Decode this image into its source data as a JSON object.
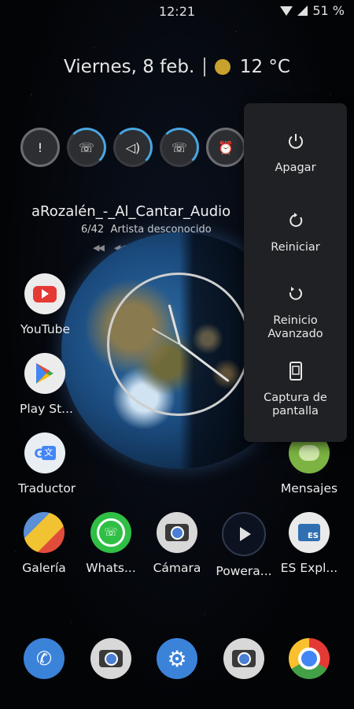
{
  "status_bar": {
    "time": "12:21",
    "battery": "51 %"
  },
  "header": {
    "date": "Viernes, 8 feb.",
    "temperature": "12 °C"
  },
  "music": {
    "title": "aRozalén_-_Al_Cantar_Audio",
    "track": "6/42",
    "artist": "Artista desconocido"
  },
  "home_apps": [
    {
      "label": "YouTube"
    },
    {
      "label": "Play St..."
    },
    {
      "label": "Traductor"
    },
    {
      "label": "Mensajes"
    },
    {
      "label": "Galería"
    },
    {
      "label": "Whats..."
    },
    {
      "label": "Cámara"
    },
    {
      "label": "Powera..."
    },
    {
      "label": "ES Expl..."
    }
  ],
  "power_menu": {
    "items": [
      {
        "label": "Apagar",
        "icon": "power-icon"
      },
      {
        "label": "Reiniciar",
        "icon": "restart-icon"
      },
      {
        "label": "Reinicio Avanzado",
        "icon": "advanced-restart-icon"
      },
      {
        "label": "Captura de pantalla",
        "icon": "screenshot-icon"
      }
    ]
  },
  "colors": {
    "accent_ring": "#49a6e0",
    "menu_bg": "#202124",
    "sun": "#c8a22c"
  }
}
